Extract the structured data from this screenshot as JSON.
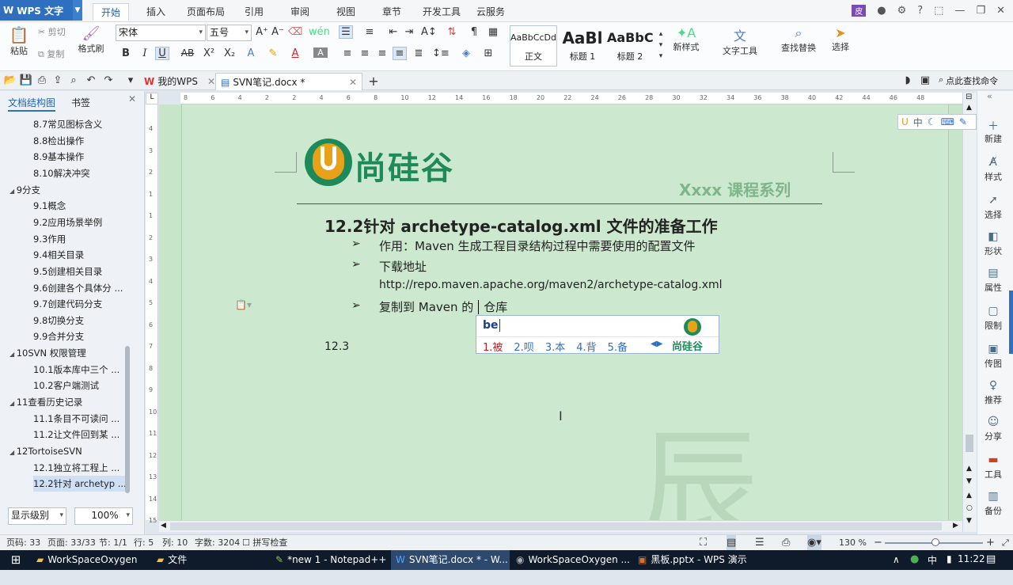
{
  "app": {
    "name": "WPS 文字",
    "menu_tabs": [
      "开始",
      "插入",
      "页面布局",
      "引用",
      "审阅",
      "视图",
      "章节",
      "开发工具",
      "云服务"
    ],
    "active_tab": "开始"
  },
  "ribbon": {
    "paste": "粘贴",
    "cut": "剪切",
    "copy": "复制",
    "format_painter": "格式刷",
    "font": "宋体",
    "size": "五号",
    "styles": [
      {
        "preview": "AaBbCcDd",
        "name": "正文"
      },
      {
        "preview": "AaBl",
        "name": "标题 1"
      },
      {
        "preview": "AaBbC",
        "name": "标题 2"
      }
    ],
    "new_style": "新样式",
    "text_tools": "文字工具",
    "find_replace": "查找替换",
    "select": "选择",
    "btn_bold": "B",
    "btn_italic": "I",
    "btn_underline": "U",
    "btn_strike": "AB",
    "btn_sup": "X²",
    "btn_sub": "X₂"
  },
  "tabs": {
    "items": [
      {
        "label": "我的WPS"
      },
      {
        "label": "SVN笔记.docx *"
      }
    ],
    "search": "点此查找命令"
  },
  "nav": {
    "tab_outline": "文档结构图",
    "tab_bookmark": "书签",
    "items": [
      {
        "level": 2,
        "label": "8.7常见图标含义"
      },
      {
        "level": 2,
        "label": "8.8检出操作"
      },
      {
        "level": 2,
        "label": "8.9基本操作"
      },
      {
        "level": 2,
        "label": "8.10解决冲突"
      },
      {
        "level": 1,
        "label": "9分支"
      },
      {
        "level": 2,
        "label": "9.1概念"
      },
      {
        "level": 2,
        "label": "9.2应用场景举例"
      },
      {
        "level": 2,
        "label": "9.3作用"
      },
      {
        "level": 2,
        "label": "9.4相关目录"
      },
      {
        "level": 2,
        "label": "9.5创建相关目录"
      },
      {
        "level": 2,
        "label": "9.6创建各个具体分 ..."
      },
      {
        "level": 2,
        "label": "9.7创建代码分支"
      },
      {
        "level": 2,
        "label": "9.8切换分支"
      },
      {
        "level": 2,
        "label": "9.9合并分支"
      },
      {
        "level": 1,
        "label": "10SVN 权限管理"
      },
      {
        "level": 2,
        "label": "10.1版本库中三个 ..."
      },
      {
        "level": 2,
        "label": "10.2客户端测试"
      },
      {
        "level": 1,
        "label": "11查看历史记录"
      },
      {
        "level": 2,
        "label": "11.1条目不可读问 ..."
      },
      {
        "level": 2,
        "label": "11.2让文件回到某 ..."
      },
      {
        "level": 1,
        "label": "12TortoiseSVN"
      },
      {
        "level": 2,
        "label": "12.1独立将工程上 ..."
      },
      {
        "level": 2,
        "label": "12.2针对 archetyp ..."
      }
    ],
    "display_level": "显示级别",
    "zoom": "100%"
  },
  "ruler": {
    "marks": [
      "8",
      "6",
      "4",
      "2",
      "2",
      "4",
      "6",
      "8",
      "10",
      "12",
      "14",
      "16",
      "18",
      "20",
      "22",
      "24",
      "26",
      "28",
      "30",
      "32",
      "34",
      "36",
      "38",
      "40",
      "42",
      "44",
      "46",
      "48"
    ],
    "vmarks": [
      "4",
      "3",
      "2",
      "1",
      "1",
      "2",
      "3",
      "4",
      "5",
      "6",
      "7",
      "8",
      "9",
      "10",
      "11",
      "12",
      "13",
      "14",
      "15"
    ]
  },
  "document": {
    "logo_text": "尚硅谷",
    "series": "Xxxx 课程系列",
    "heading_num": "12.2",
    "heading_pre": "针对 ",
    "heading_bold": "archetype-catalog.xml",
    "heading_post": " 文件的准备工作",
    "bullets": [
      "作用：Maven 生成工程目录结构过程中需要使用的配置文件",
      "下载地址"
    ],
    "url": "http://repo.maven.apache.org/maven2/archetype-catalog.xml",
    "bullet3_pre": "复制到 Maven 的",
    "bullet3_post": "仓库",
    "next_heading": "12.3"
  },
  "ime": {
    "input": "be",
    "candidates": [
      "1.被",
      "2.呗",
      "3.本",
      "4.背",
      "5.备"
    ],
    "brand": "尚硅谷",
    "toolbar": "中"
  },
  "sidebar": [
    "新建",
    "样式",
    "选择",
    "形状",
    "属性",
    "限制",
    "传图",
    "推荐",
    "分享",
    "工具",
    "备份"
  ],
  "status": {
    "page": "页码: 33",
    "pages": "页面: 33/33",
    "section": "节: 1/1",
    "row": "行: 5",
    "col": "列: 10",
    "words": "字数: 3204",
    "spell": "拼写检查",
    "zoom": "130 %"
  },
  "taskbar": {
    "items": [
      "WorkSpaceOxygen",
      "文件",
      "*new 1 - Notepad++",
      "SVN笔记.docx * - W...",
      "WorkSpaceOxygen ...",
      "黑板.pptx - WPS 演示"
    ],
    "ime": "中",
    "time": "11:22"
  },
  "colors": {
    "accent": "#2e6fbf",
    "page_bg": "#cce8cf",
    "brand_orange": "#e8a21a",
    "brand_green": "#1e8a5a",
    "series_green": "#7fb58a"
  }
}
